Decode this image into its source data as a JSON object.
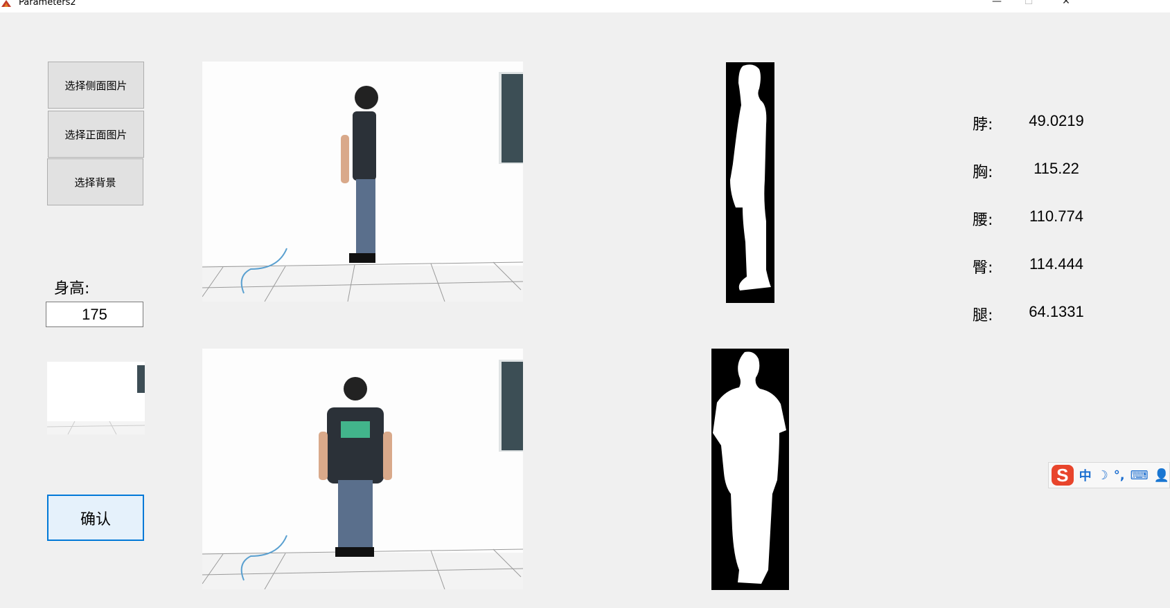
{
  "window": {
    "title": "Parameters2",
    "controls": {
      "minimize": "—",
      "maximize": "☐",
      "close": "✕"
    }
  },
  "buttons": {
    "side_image": "选择侧面图片",
    "front_image": "选择正面图片",
    "background": "选择背景",
    "confirm": "确认"
  },
  "height": {
    "label": "身高:",
    "value": "175"
  },
  "measurements": [
    {
      "label": "脖:",
      "value": "49.0219"
    },
    {
      "label": "胸:",
      "value": "115.22"
    },
    {
      "label": "腰:",
      "value": "110.774"
    },
    {
      "label": "臀:",
      "value": "114.444"
    },
    {
      "label": "腿:",
      "value": "64.1331"
    }
  ],
  "ime": {
    "logo": "S",
    "mode": "中",
    "moon": "☽",
    "punct": "°,",
    "keyboard": "⌨",
    "user": "👤"
  },
  "colors": {
    "accent": "#0078d7",
    "sogou": "#e8452c",
    "shirt": "#2b3138",
    "jeans": "#5a6f8c",
    "logo_green": "#49d6a0"
  }
}
